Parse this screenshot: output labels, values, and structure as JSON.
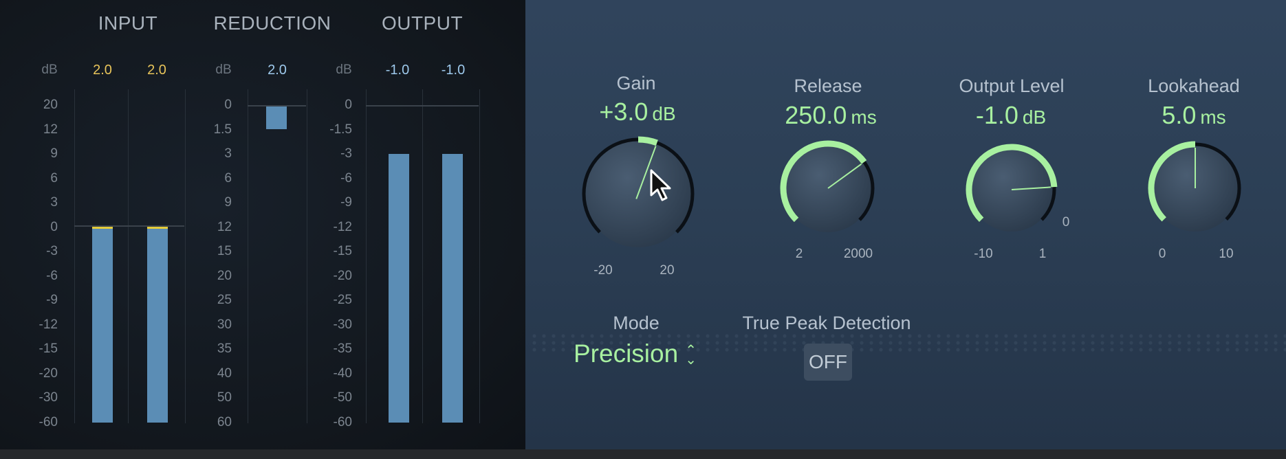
{
  "meters": {
    "input": {
      "title": "INPUT",
      "db_label": "dB",
      "peaks": [
        "2.0",
        "2.0"
      ],
      "scale": [
        "20",
        "12",
        "9",
        "6",
        "3",
        "0",
        "-3",
        "-6",
        "-9",
        "-12",
        "-15",
        "-20",
        "-30",
        "-60"
      ],
      "levels_db": [
        0,
        0
      ]
    },
    "reduction": {
      "title": "REDUCTION",
      "db_label": "dB",
      "peak": "2.0",
      "scale": [
        "0",
        "1.5",
        "3",
        "6",
        "9",
        "12",
        "15",
        "20",
        "25",
        "30",
        "35",
        "40",
        "50",
        "60"
      ],
      "amount_db": 1.5
    },
    "output": {
      "title": "OUTPUT",
      "db_label": "dB",
      "peaks": [
        "-1.0",
        "-1.0"
      ],
      "scale": [
        "0",
        "-1.5",
        "-3",
        "-6",
        "-9",
        "-12",
        "-15",
        "-20",
        "-25",
        "-30",
        "-35",
        "-40",
        "-50",
        "-60"
      ],
      "levels_db": [
        -3,
        -3
      ]
    }
  },
  "knobs": {
    "gain": {
      "title": "Gain",
      "value": "+3.0",
      "unit": "dB",
      "min_label": "-20",
      "max_label": "20",
      "fraction": 0.575
    },
    "release": {
      "title": "Release",
      "value": "250.0",
      "unit": "ms",
      "min_label": "2",
      "max_label": "2000",
      "fraction": 0.7
    },
    "output_level": {
      "title": "Output Level",
      "value": "-1.0",
      "unit": "dB",
      "min_label": "-10",
      "max_label": "1",
      "mid_label": "0",
      "fraction": 0.82
    },
    "lookahead": {
      "title": "Lookahead",
      "value": "5.0",
      "unit": "ms",
      "min_label": "0",
      "max_label": "10",
      "fraction": 0.5
    }
  },
  "mode": {
    "title": "Mode",
    "value": "Precision"
  },
  "true_peak": {
    "title": "True Peak Detection",
    "button_label": "OFF"
  },
  "colors": {
    "accent_green": "#a8f0a0",
    "meter_blue": "#5b8db5",
    "peak_yellow": "#e8c45a",
    "panel_blue": "#2c3f55"
  },
  "icons": {
    "mode_arrows": "up-down-chevron-icon",
    "cursor": "mouse-pointer-icon"
  }
}
